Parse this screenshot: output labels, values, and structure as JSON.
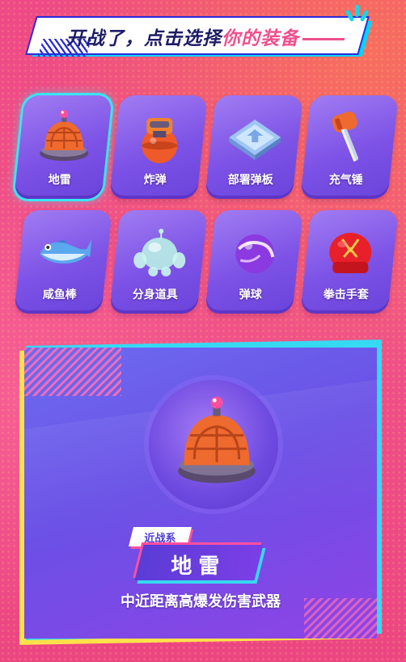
{
  "header": {
    "title_prefix": "开战了，点击选择",
    "title_highlight": "你的装备"
  },
  "equipment": [
    {
      "label": "地雷",
      "icon": "landmine-icon",
      "selected": true
    },
    {
      "label": "炸弹",
      "icon": "bomb-icon",
      "selected": false
    },
    {
      "label": "部署弹板",
      "icon": "bounce-pad-icon",
      "selected": false
    },
    {
      "label": "充气锤",
      "icon": "inflatable-hammer-icon",
      "selected": false
    },
    {
      "label": "咸鱼棒",
      "icon": "salted-fish-icon",
      "selected": false
    },
    {
      "label": "分身道具",
      "icon": "clone-jelly-icon",
      "selected": false
    },
    {
      "label": "弹球",
      "icon": "bouncing-ball-icon",
      "selected": false
    },
    {
      "label": "拳击手套",
      "icon": "boxing-glove-icon",
      "selected": false
    }
  ],
  "detail": {
    "category": "近战系",
    "name": "地雷",
    "description": "中近距离高爆发伤害武器",
    "icon": "landmine-icon"
  },
  "colors": {
    "background": "#f0508c",
    "card": "#7d52e6",
    "selected_glow": "#39e5f4",
    "accent_pink": "#f0508c",
    "accent_yellow": "#ffe14a"
  }
}
